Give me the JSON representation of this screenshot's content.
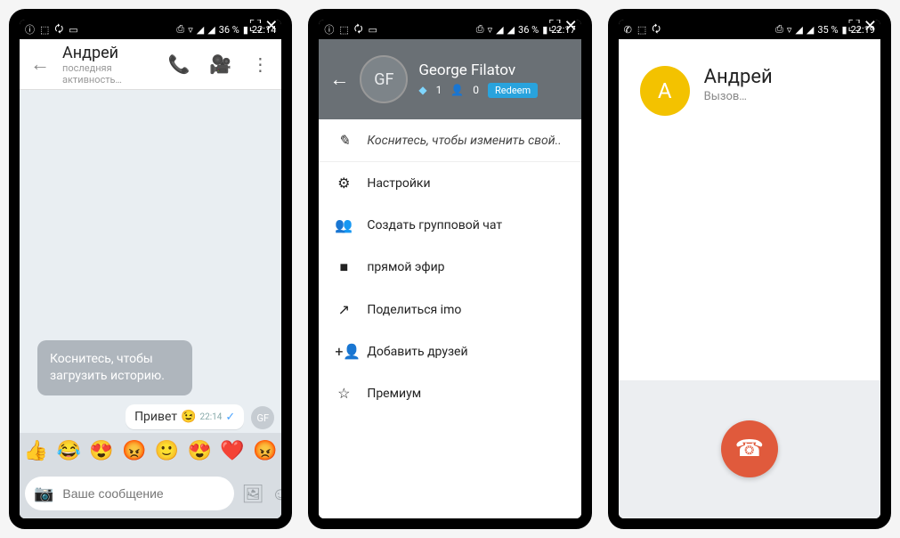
{
  "phone1": {
    "status": {
      "battery": "36 %",
      "time": "22:14"
    },
    "header": {
      "title": "Андрей",
      "subtitle": "последняя активность…"
    },
    "info_bubble": "Коснитесь, чтобы загрузить историю.",
    "out_msg": {
      "text": "Привет",
      "emoji": "😉",
      "time": "22:14",
      "initials": "GF"
    },
    "emojis": [
      "👍",
      "😂",
      "😍",
      "😡",
      "🙂",
      "😍",
      "❤️",
      "😡"
    ],
    "input": {
      "placeholder": "Ваше сообщение"
    }
  },
  "phone2": {
    "status": {
      "battery": "36 %",
      "time": "22:17"
    },
    "profile": {
      "initials": "GF",
      "name": "George Filatov",
      "diamonds": "1",
      "friends": "0",
      "redeem": "Redeem"
    },
    "items": [
      {
        "icon": "✎",
        "label": "Коснитесь, чтобы изменить свой.."
      },
      {
        "icon": "⚙",
        "label": "Настройки"
      },
      {
        "icon": "👥",
        "label": "Создать групповой чат"
      },
      {
        "icon": "■",
        "label": "прямой эфир"
      },
      {
        "icon": "↗",
        "label": "Поделиться imo"
      },
      {
        "icon": "+👤",
        "label": "Добавить друзей"
      },
      {
        "icon": "☆",
        "label": "Премиум"
      }
    ]
  },
  "phone3": {
    "status": {
      "battery": "35 %",
      "time": "22:19"
    },
    "call": {
      "initial": "А",
      "name": "Андрей",
      "state": "Вызов…"
    }
  }
}
